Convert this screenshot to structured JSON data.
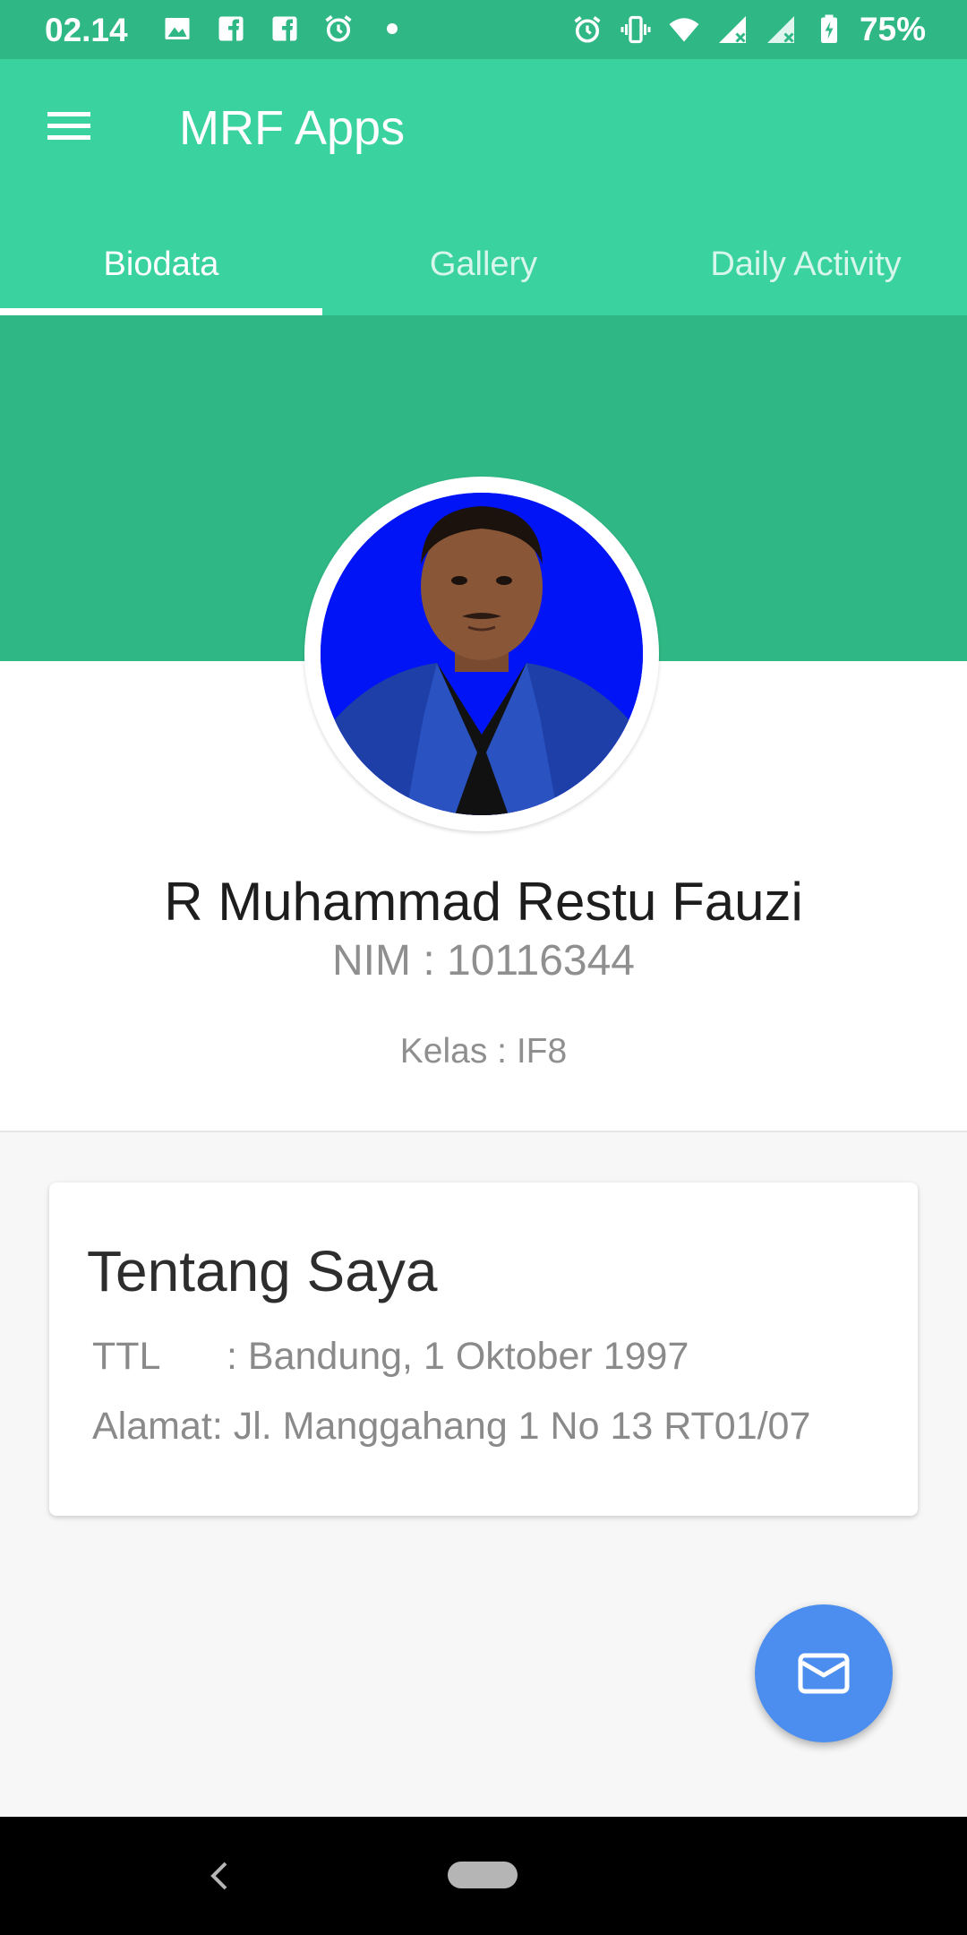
{
  "status_bar": {
    "time": "02.14",
    "left_icons": [
      "image-icon",
      "facebook-icon",
      "facebook-icon",
      "alarm-icon",
      "dot-icon"
    ],
    "right_icons": [
      "alarm-icon",
      "vibrate-icon",
      "wifi-icon",
      "signal-icon",
      "signal-icon",
      "battery-charging-icon"
    ],
    "battery": "75%"
  },
  "app_bar": {
    "title": "MRF Apps",
    "menu_icon": "hamburger-menu-icon",
    "color": "#3ad29f"
  },
  "tabs": [
    {
      "label": "Biodata",
      "active": true
    },
    {
      "label": "Gallery",
      "active": false
    },
    {
      "label": "Daily Activity",
      "active": false
    }
  ],
  "profile": {
    "name": "R Muhammad Restu Fauzi",
    "nim": "NIM : 10116344",
    "kelas": "Kelas : IF8",
    "hero_color": "#2fb885"
  },
  "about_card": {
    "title": "Tentang Saya",
    "ttl_label": "TTL",
    "ttl_value": ": Bandung, 1 Oktober 1997",
    "alamat_label": "Alamat",
    "alamat_value": ": Jl. Manggahang 1 No 13 RT01/07"
  },
  "fab": {
    "icon": "email-icon",
    "color": "#4b8ef0"
  },
  "nav_bar": {
    "back_icon": "back-chevron-icon",
    "home_icon": "home-pill-icon"
  }
}
